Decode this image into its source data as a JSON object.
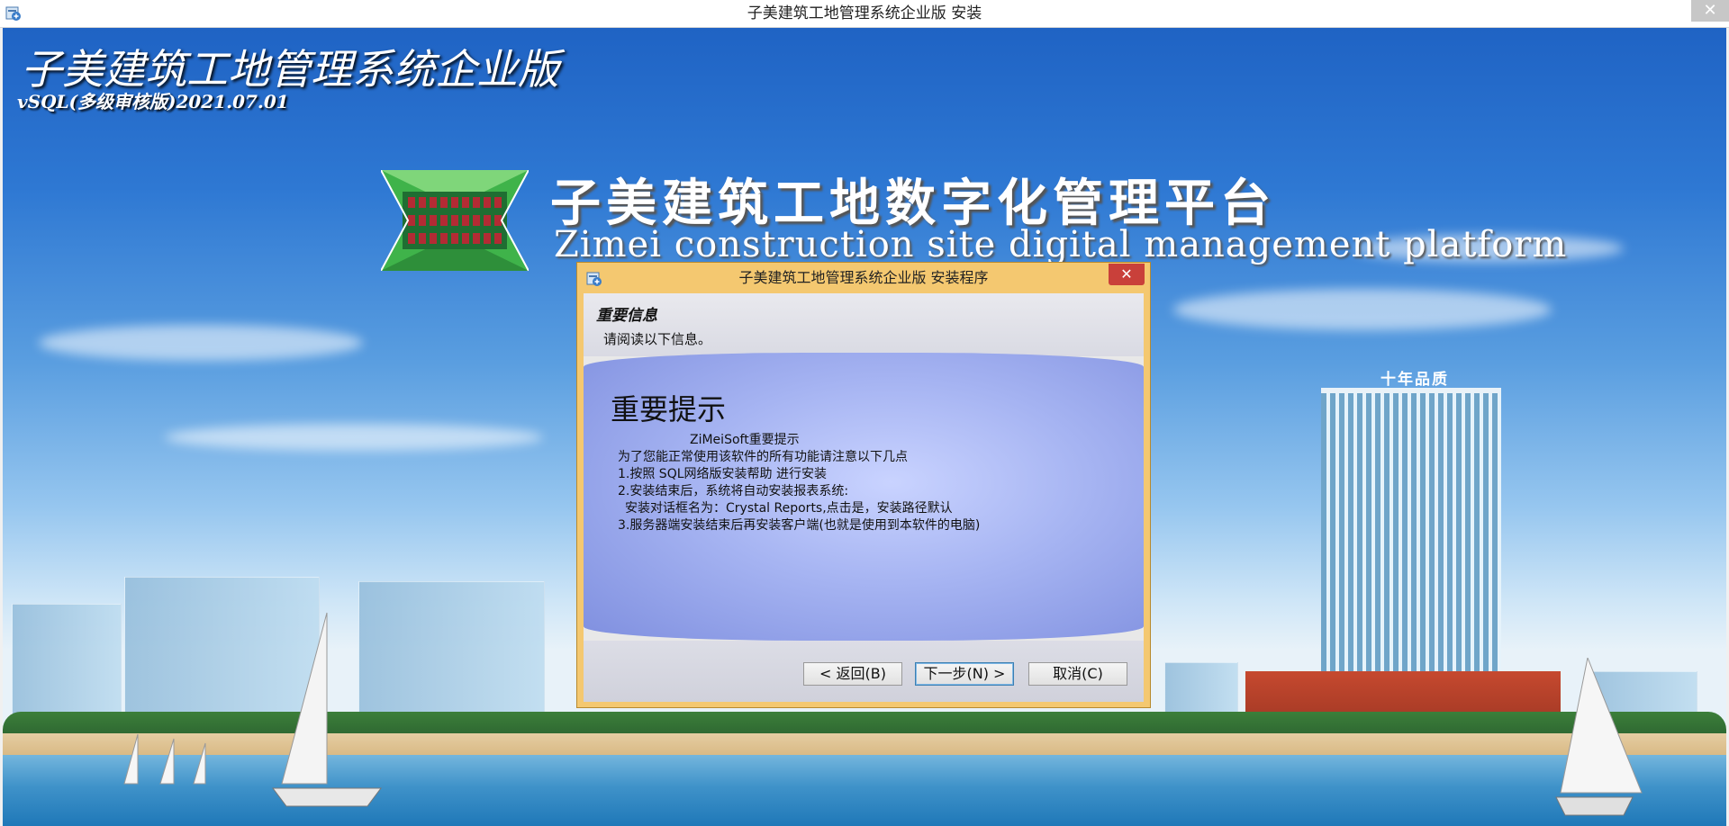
{
  "window": {
    "title": "子美建筑工地管理系统企业版 安装",
    "close_symbol": "✕"
  },
  "background": {
    "product_title": "子美建筑工地管理系统企业版",
    "product_version": "vSQL(多级审核版)2021.07.01",
    "platform_title_cn": "子美建筑工地数字化管理平台",
    "platform_title_en": "Zimei construction site digital management platform",
    "tower_sign": "十年品质"
  },
  "dialog": {
    "title": "子美建筑工地管理系统企业版 安装程序",
    "close_symbol": "✕",
    "header": {
      "title": "重要信息",
      "subtitle": "请阅读以下信息。"
    },
    "content": {
      "heading": "重要提示",
      "lines": [
        "ZiMeiSoft重要提示",
        "为了您能正常使用该软件的所有功能请注意以下几点",
        "1.按照 SQL网络版安装帮助 进行安装",
        "2.安装结束后，系统将自动安装报表系统:",
        "安装对话框名为：Crystal Reports,点击是，安装路径默认",
        "3.服务器端安装结束后再安装客户端(也就是使用到本软件的电脑)"
      ]
    },
    "buttons": {
      "back": "< 返回(B)",
      "next": "下一步(N) >",
      "cancel": "取消(C)"
    }
  },
  "colors": {
    "dialog_frame": "#f4c870",
    "close_red": "#c9403a",
    "content_blue": "#a6b4f2"
  },
  "icons": [
    "installer-app-icon",
    "close-icon",
    "logo-icon"
  ]
}
